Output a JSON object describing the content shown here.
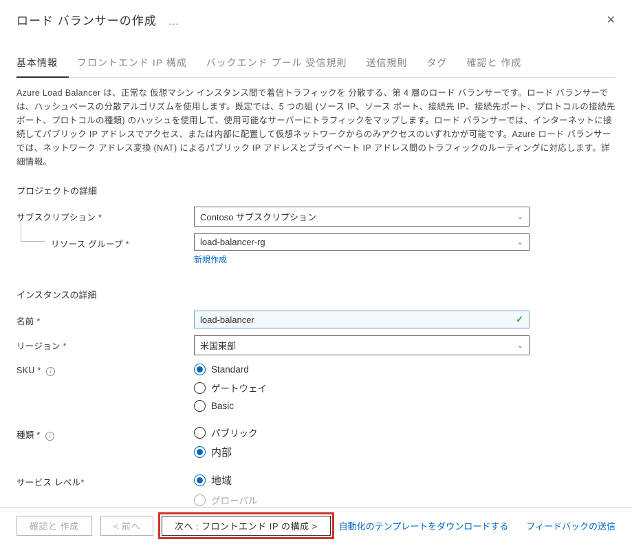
{
  "header": {
    "title": "ロード バランサーの作成",
    "more": "…"
  },
  "tabs": {
    "t0": "基本情報",
    "t1": "フロントエンド IP 構成",
    "t2": "バックエンド プール 受信規則",
    "t3": "送信規則",
    "t4": "タグ",
    "t5": "確認と 作成"
  },
  "description": "Azure Load Balancer は、正常な 仮想マシン インスタンス間で着信トラフィックを 分散する、第 4 層のロード バランサーです。ロード バランサーでは、ハッシュベースの分散アルゴリズムを使用します。既定では、5 つの組 (ソース IP、ソース ポート、接続先 IP、接続先ポート、プロトコルの接続先ポート、プロトコルの種類) のハッシュを使用して、使用可能なサーバーにトラフィックをマップします。ロード バランサーでは、インターネットに接続してパブリック IP アドレスでアクセス、または内部に配置して仮想ネットワークからのみアクセスのいずれかが可能です。Azure ロード バランサーでは、ネットワーク アドレス変換 (NAT) によるパブリック IP アドレスとプライベート IP アドレス間のトラフィックのルーティングに対応します。詳細情報。",
  "section_project": "プロジェクトの詳細",
  "labels": {
    "subscription": "サブスクリプション",
    "resourceGroup": "リソース グループ",
    "newLink": "新規作成",
    "name": "名前",
    "region": "リージョン",
    "sku": "SKU",
    "type": "種類",
    "tier": "サービス レベル"
  },
  "section_instance": "インスタンスの詳細",
  "values": {
    "subscription": "Contoso サブスクリプション",
    "resourceGroup": "load-balancer-rg",
    "name": "load-balancer",
    "region": "米国東部"
  },
  "radios": {
    "sku_standard": "Standard",
    "sku_gateway": "ゲートウェイ",
    "sku_basic": "Basic",
    "type_public": "パブリック",
    "type_internal": "内部",
    "tier_regional": "地域",
    "tier_global": "グローバル"
  },
  "footer": {
    "review": "確認と 作成",
    "prev": "< 前へ",
    "next": "次へ : フロントエンド IP の構成  >",
    "download": "自動化のテンプレートをダウンロードする",
    "feedback": "フィードバックの送信"
  }
}
